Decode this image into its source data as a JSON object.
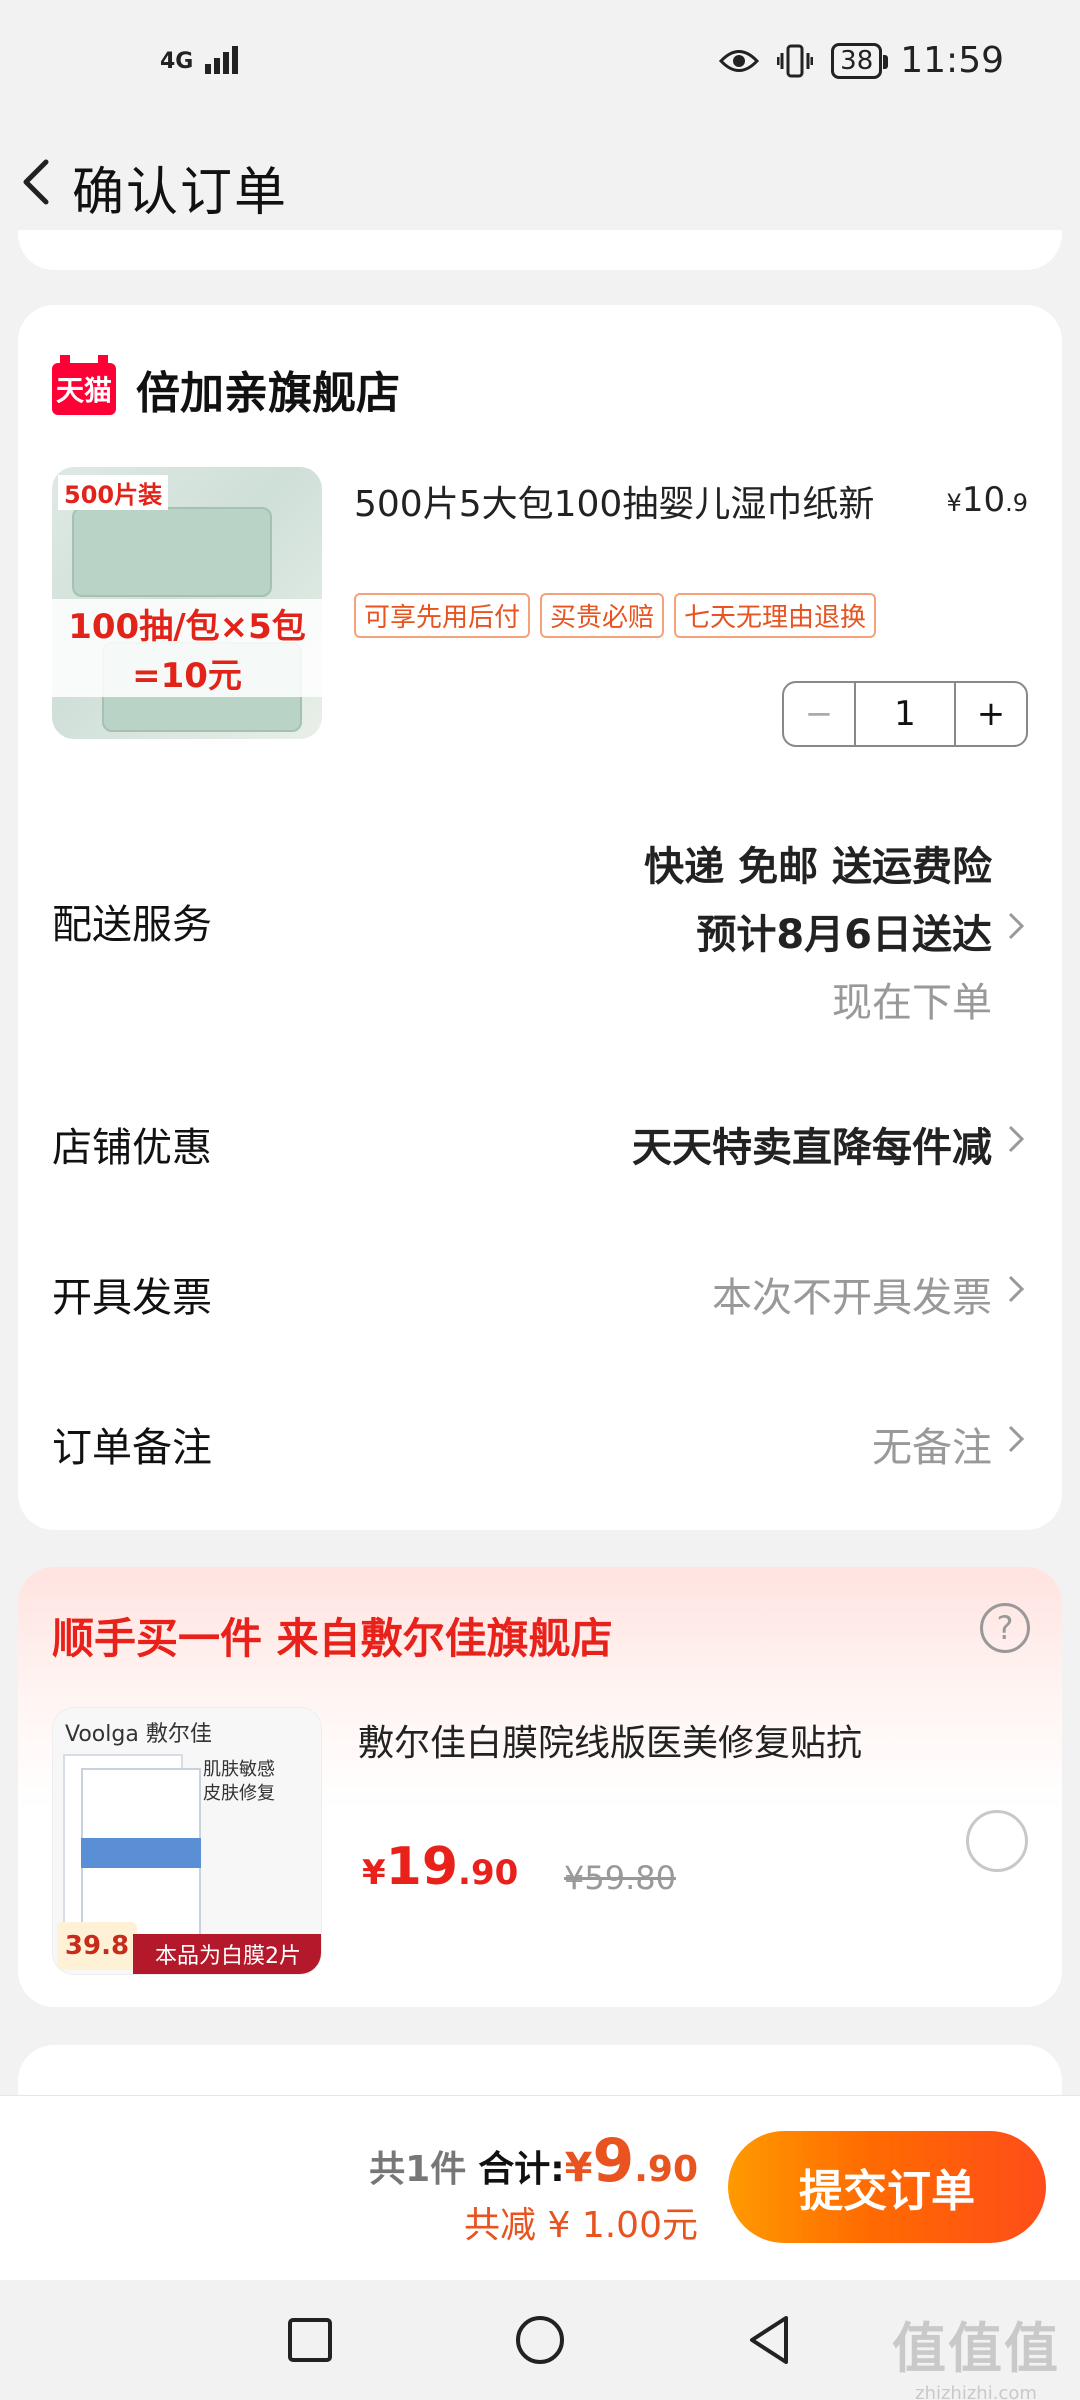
{
  "status_bar": {
    "network": "4G",
    "battery": "38",
    "time": "11:59"
  },
  "header": {
    "title": "确认订单"
  },
  "shop": {
    "logo_text": "天猫",
    "name": "倍加亲旗舰店"
  },
  "product": {
    "title": "500片5大包100抽婴儿湿巾纸新",
    "price_currency": "¥",
    "price_int": "10",
    "price_dec": ".9",
    "image_tag": "500片装",
    "image_banner": "100抽/包×5包=10元",
    "tags": [
      "可享先用后付",
      "买贵必赔",
      "七天无理由退换"
    ],
    "quantity": "1",
    "minus": "−",
    "plus": "+"
  },
  "rows": {
    "delivery": {
      "label": "配送服务",
      "line1": "快递 免邮 送运费险",
      "line2": "预计8月6日送达",
      "line3": "现在下单"
    },
    "discount": {
      "label": "店铺优惠",
      "value": "天天特卖直降每件减"
    },
    "invoice": {
      "label": "开具发票",
      "value": "本次不开具发票"
    },
    "remark": {
      "label": "订单备注",
      "value": "无备注"
    }
  },
  "upsell": {
    "title": "顺手买一件  来自敷尔佳旗舰店",
    "help": "?",
    "product_title": "敷尔佳白膜院线版医美修复贴抗",
    "price_currency": "¥",
    "price_int": "19",
    "price_dec": ".90",
    "old_price": "¥59.80",
    "image_brand": "Voolga 敷尔佳",
    "image_bubble": "肌肤敏感\n皮肤修复",
    "image_band": "本品为白膜2片",
    "image_price": "39.8"
  },
  "bottom": {
    "count": "共1件",
    "total_label": "合计:",
    "total_currency": "¥",
    "total_int": "9",
    "total_dec": ".90",
    "discount": "共减 ¥ 1.00元",
    "submit": "提交订单"
  },
  "watermark": {
    "big": "值值值",
    "small": "zhizhizhi.com"
  },
  "colors": {
    "accent_orange": "#e8531f",
    "accent_red": "#e8221b",
    "tmall_red": "#ff0036"
  }
}
